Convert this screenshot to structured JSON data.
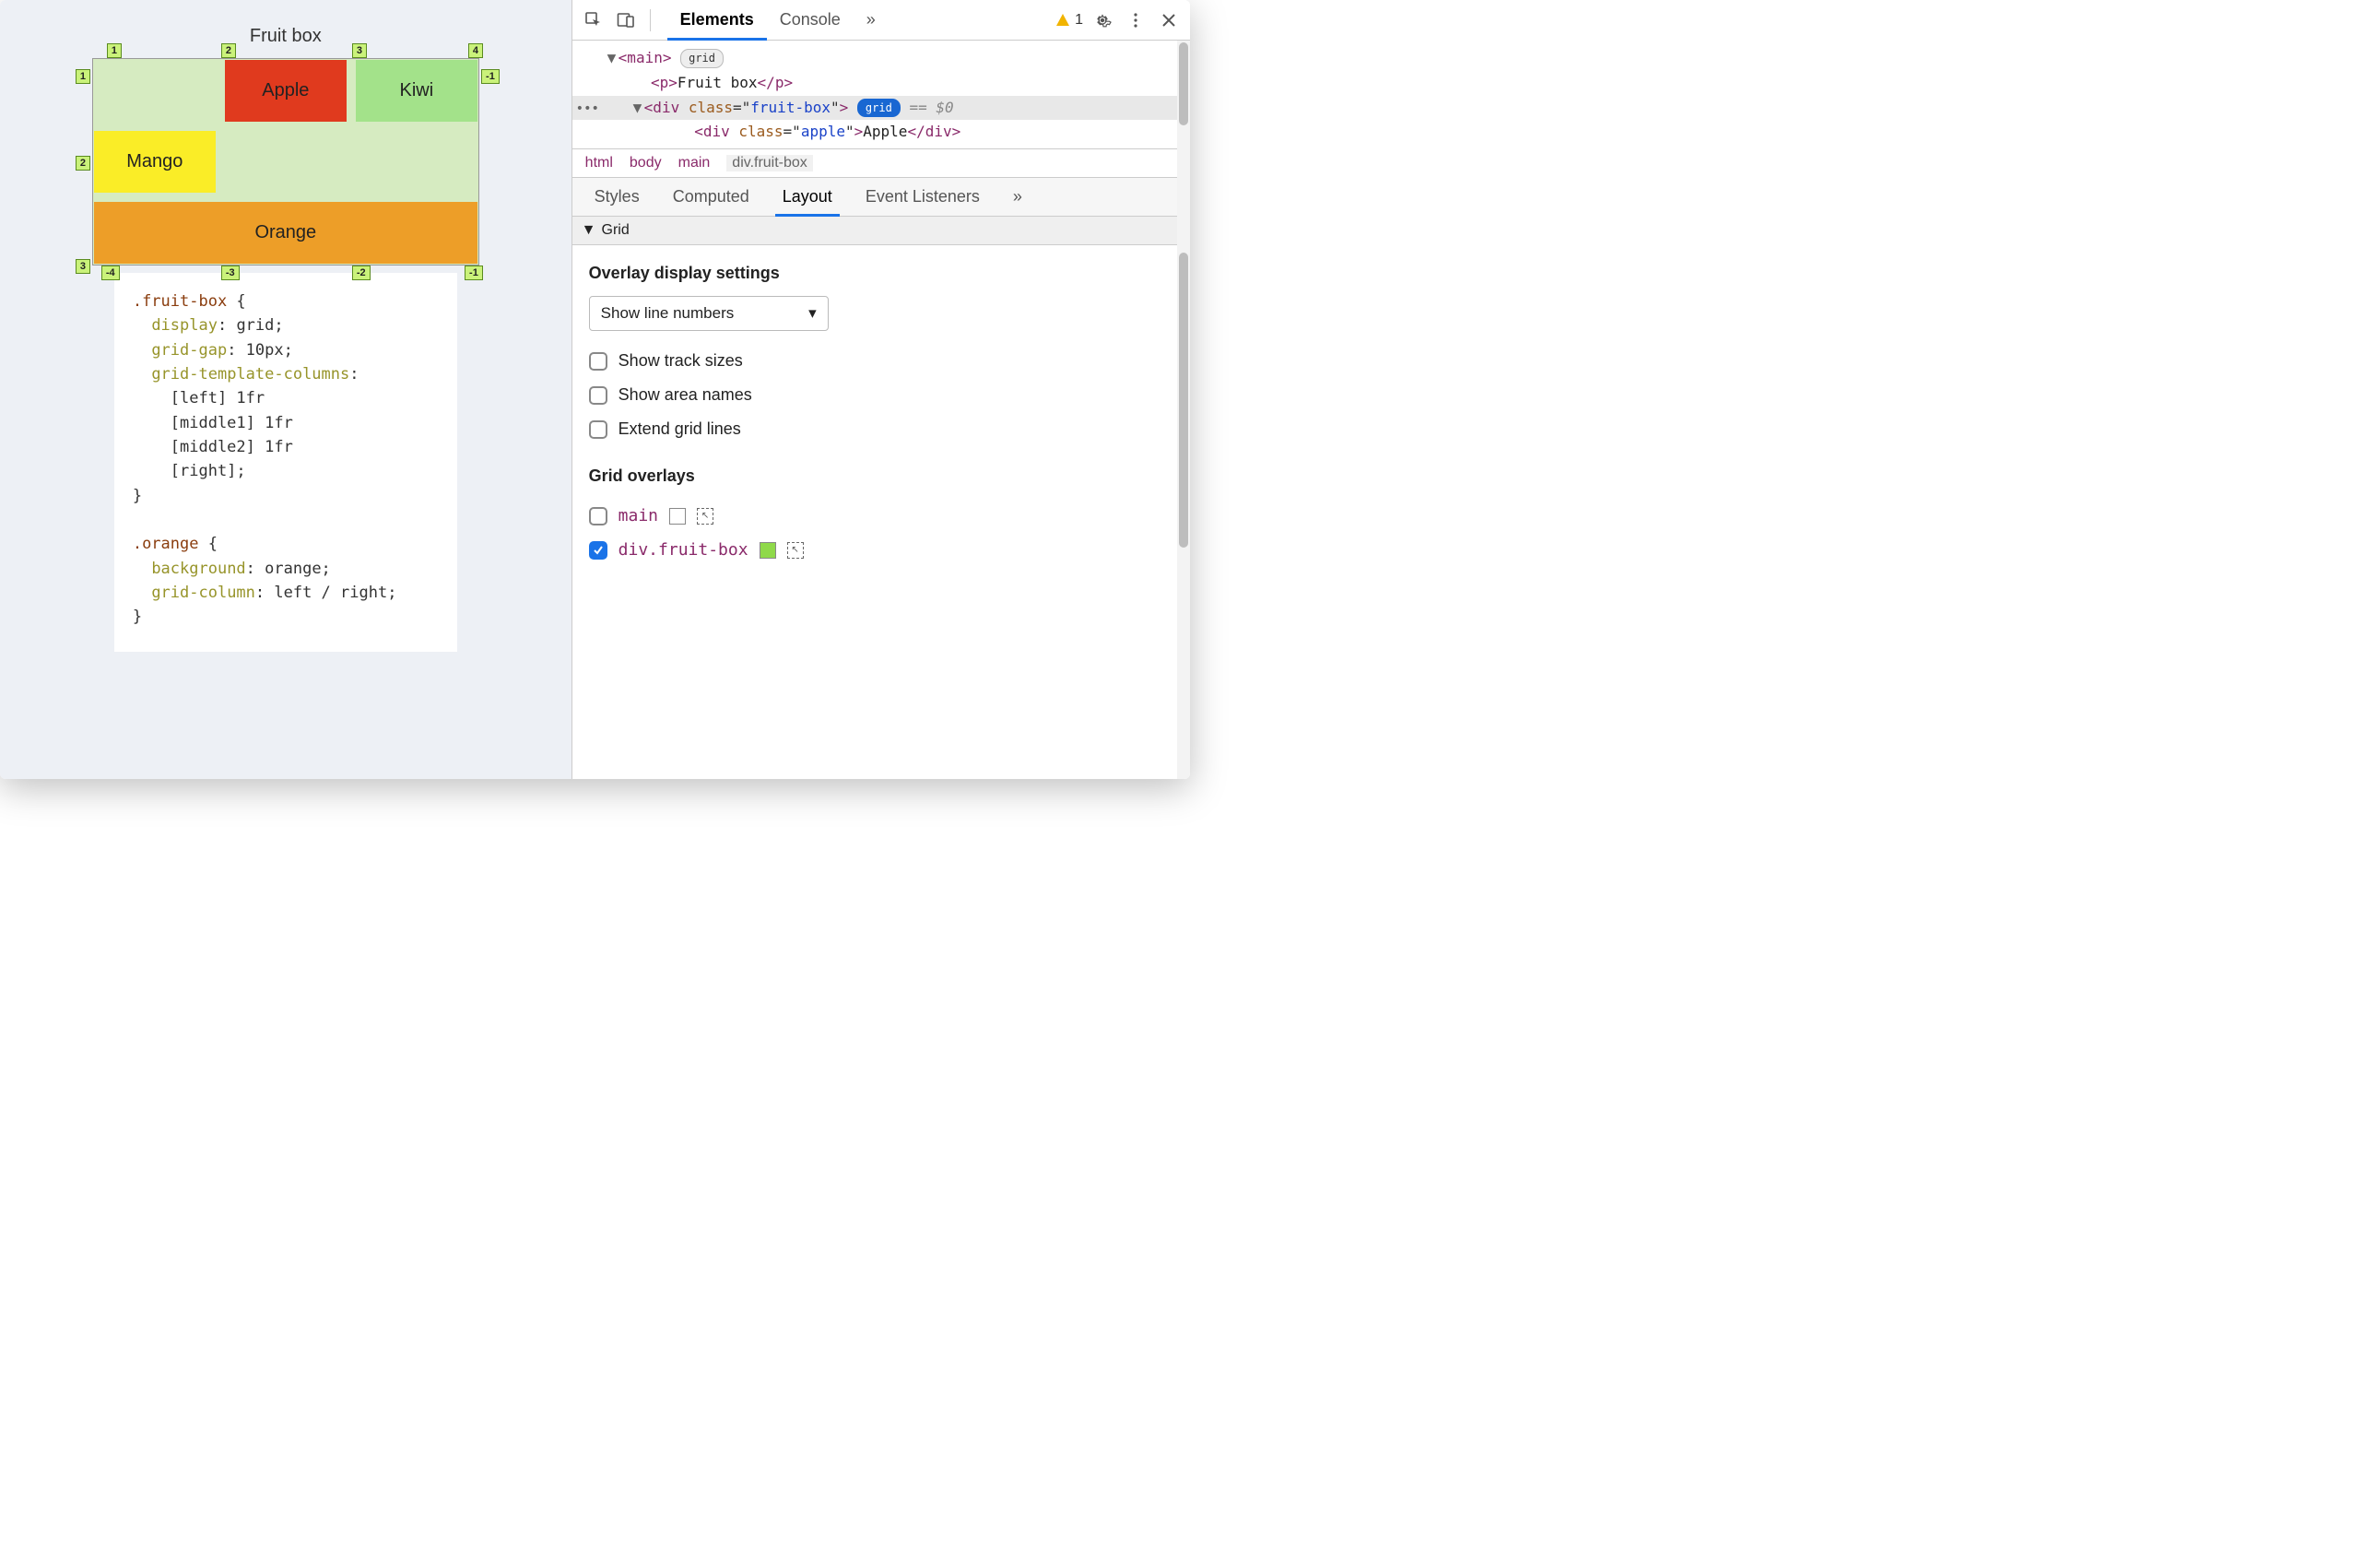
{
  "page": {
    "title": "Fruit box",
    "cells": {
      "apple": "Apple",
      "kiwi": "Kiwi",
      "mango": "Mango",
      "orange": "Orange"
    },
    "line_labels": {
      "top": [
        "1",
        "2",
        "3",
        "4"
      ],
      "left": [
        "1",
        "2",
        "3"
      ],
      "right": [
        "-1"
      ],
      "bottom": [
        "-4",
        "-3",
        "-2",
        "-1"
      ]
    },
    "css": ".fruit-box {\n  display: grid;\n  grid-gap: 10px;\n  grid-template-columns:\n    [left] 1fr\n    [middle1] 1fr\n    [middle2] 1fr\n    [right];\n}\n\n.orange {\n  background: orange;\n  grid-column: left / right;\n}"
  },
  "devtools": {
    "tabs": {
      "elements": "Elements",
      "console": "Console"
    },
    "warn_count": "1",
    "dom": {
      "main_open": "<main>",
      "main_badge": "grid",
      "p_line": "<p>Fruit box</p>",
      "fruitbox_open": "<div class=\"fruit-box\">",
      "fruitbox_badge": "grid",
      "fruitbox_suffix": "== $0",
      "apple_line": "<div class=\"apple\">Apple</div>"
    },
    "crumbs": [
      "html",
      "body",
      "main",
      "div.fruit-box"
    ],
    "subtabs": {
      "styles": "Styles",
      "computed": "Computed",
      "layout": "Layout",
      "listeners": "Event Listeners"
    },
    "grid_section": "Grid",
    "overlay_settings_h": "Overlay display settings",
    "line_select": "Show line numbers",
    "opt_track": "Show track sizes",
    "opt_area": "Show area names",
    "opt_extend": "Extend grid lines",
    "overlays_h": "Grid overlays",
    "overlays": [
      {
        "label": "main",
        "checked": false,
        "swatch": "#a5e05a"
      },
      {
        "label": "div.fruit-box",
        "checked": true,
        "swatch": "#8fd94a"
      }
    ]
  }
}
